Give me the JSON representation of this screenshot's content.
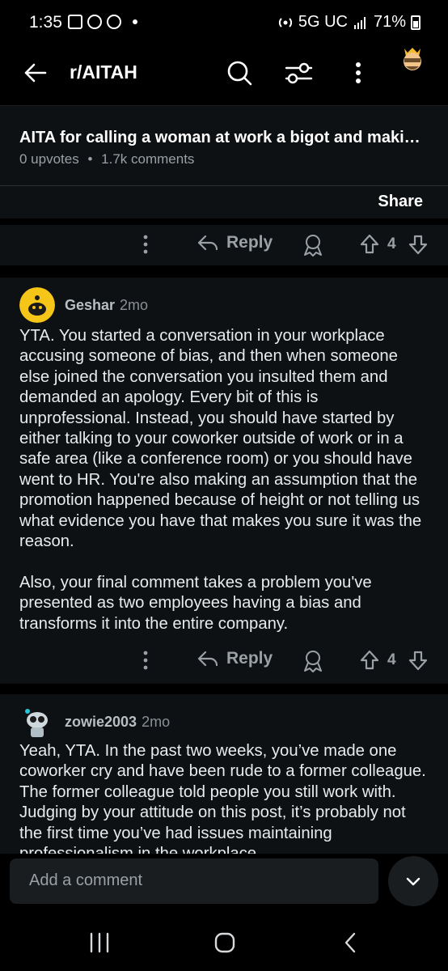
{
  "status_bar": {
    "time": "1:35",
    "network": "5G UC",
    "battery": "71%"
  },
  "app_bar": {
    "subreddit": "r/AITAH",
    "icons": [
      "back-arrow-icon",
      "search-icon",
      "filter-icon",
      "more-vertical-icon",
      "snoo-avatar-icon"
    ]
  },
  "post": {
    "title": "AITA for calling a woman at work a bigot and maki…",
    "upvotes": "0 upvotes",
    "comments": "1.7k comments",
    "meta_separator": "•",
    "share_label": "Share",
    "reply_label": "Reply",
    "vote_count": "4"
  },
  "comments": [
    {
      "username": "Geshar",
      "age": "2mo",
      "paragraphs": [
        "YTA.  You started a conversation in your workplace accusing someone of bias, and then when someone else joined the conversation you insulted them and demanded an apology.  Every bit of this is unprofessional.  Instead, you should have started by either talking to your coworker outside of work or in a safe area (like a conference room) or you should have went to HR.  You're also making an assumption that the promotion happened because of height or not telling us what evidence you have that makes you sure it was the reason.",
        "Also, your final comment takes a problem you've presented as two employees having a bias and transforms it into the entire company."
      ],
      "reply_label": "Reply",
      "vote_count": "4"
    },
    {
      "username": "zowie2003",
      "age": "2mo",
      "paragraphs": [
        "Yeah, YTA. In the past two weeks, you’ve made one coworker cry and have been rude to a former colleague. The former colleague told people you still work with. Judging by your attitude on this post, it’s probably not the first time you’ve had issues maintaining professionalism in the workplace."
      ]
    }
  ],
  "comment_input": {
    "placeholder": "Add a comment"
  },
  "colors": {
    "background": "#000000",
    "surface": "#0e1113",
    "text": "#e8eaed",
    "muted": "#9aa0a6"
  }
}
